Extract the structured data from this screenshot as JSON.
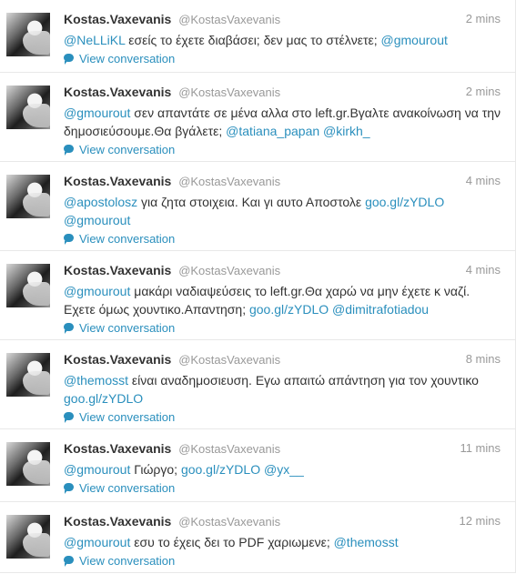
{
  "tweets": [
    {
      "fullname": "Kostas.Vaxevanis",
      "username": "@KostasVaxevanis",
      "time": "2 mins",
      "segments": [
        {
          "t": "@NeLLiKL",
          "link": true
        },
        {
          "t": " εσείς το έχετε διαβάσει; δεν μας το στέλνετε; ",
          "link": false
        },
        {
          "t": "@gmourout",
          "link": true
        }
      ],
      "conversation": "View conversation"
    },
    {
      "fullname": "Kostas.Vaxevanis",
      "username": "@KostasVaxevanis",
      "time": "2 mins",
      "segments": [
        {
          "t": "@gmourout",
          "link": true
        },
        {
          "t": " σεν απαντάτε σε μένα αλλα στο left.gr.Βγαλτε ανακοίνωση να την δημοσιεύσουμε.Θα βγάλετε; ",
          "link": false
        },
        {
          "t": "@tatiana_papan",
          "link": true
        },
        {
          "t": " ",
          "link": false
        },
        {
          "t": "@kirkh_",
          "link": true
        }
      ],
      "conversation": "View conversation"
    },
    {
      "fullname": "Kostas.Vaxevanis",
      "username": "@KostasVaxevanis",
      "time": "4 mins",
      "segments": [
        {
          "t": "@apostolosz",
          "link": true
        },
        {
          "t": " για ζητα στοιχεια. Και γι αυτο Αποστολε ",
          "link": false
        },
        {
          "t": "goo.gl/zYDLO",
          "link": true
        },
        {
          "t": " ",
          "link": false
        },
        {
          "t": "@gmourout",
          "link": true
        }
      ],
      "conversation": "View conversation"
    },
    {
      "fullname": "Kostas.Vaxevanis",
      "username": "@KostasVaxevanis",
      "time": "4 mins",
      "segments": [
        {
          "t": "@gmourout",
          "link": true
        },
        {
          "t": " μακάρι ναδιαψεύσεις το left.gr.Θα χαρώ να μην έχετε κ ναζί. Εχετε όμως χουντικο.Απαντηση; ",
          "link": false
        },
        {
          "t": "goo.gl/zYDLO",
          "link": true
        },
        {
          "t": " ",
          "link": false
        },
        {
          "t": "@dimitrafotiadou",
          "link": true
        }
      ],
      "conversation": "View conversation"
    },
    {
      "fullname": "Kostas.Vaxevanis",
      "username": "@KostasVaxevanis",
      "time": "8 mins",
      "segments": [
        {
          "t": "@themosst",
          "link": true
        },
        {
          "t": " είναι αναδημοσιευση. Εγω απαιτώ απάντηση για τον χουντικο ",
          "link": false
        },
        {
          "t": "goo.gl/zYDLO",
          "link": true
        }
      ],
      "conversation": "View conversation"
    },
    {
      "fullname": "Kostas.Vaxevanis",
      "username": "@KostasVaxevanis",
      "time": "11 mins",
      "segments": [
        {
          "t": "@gmourout",
          "link": true
        },
        {
          "t": " Γιώργο; ",
          "link": false
        },
        {
          "t": "goo.gl/zYDLO",
          "link": true
        },
        {
          "t": " ",
          "link": false
        },
        {
          "t": "@yx__",
          "link": true
        }
      ],
      "conversation": "View conversation"
    },
    {
      "fullname": "Kostas.Vaxevanis",
      "username": "@KostasVaxevanis",
      "time": "12 mins",
      "segments": [
        {
          "t": "@gmourout",
          "link": true
        },
        {
          "t": " εσυ το έχεις δει το PDF χαριωμενε; ",
          "link": false
        },
        {
          "t": "@themosst",
          "link": true
        }
      ],
      "conversation": "View conversation"
    }
  ]
}
